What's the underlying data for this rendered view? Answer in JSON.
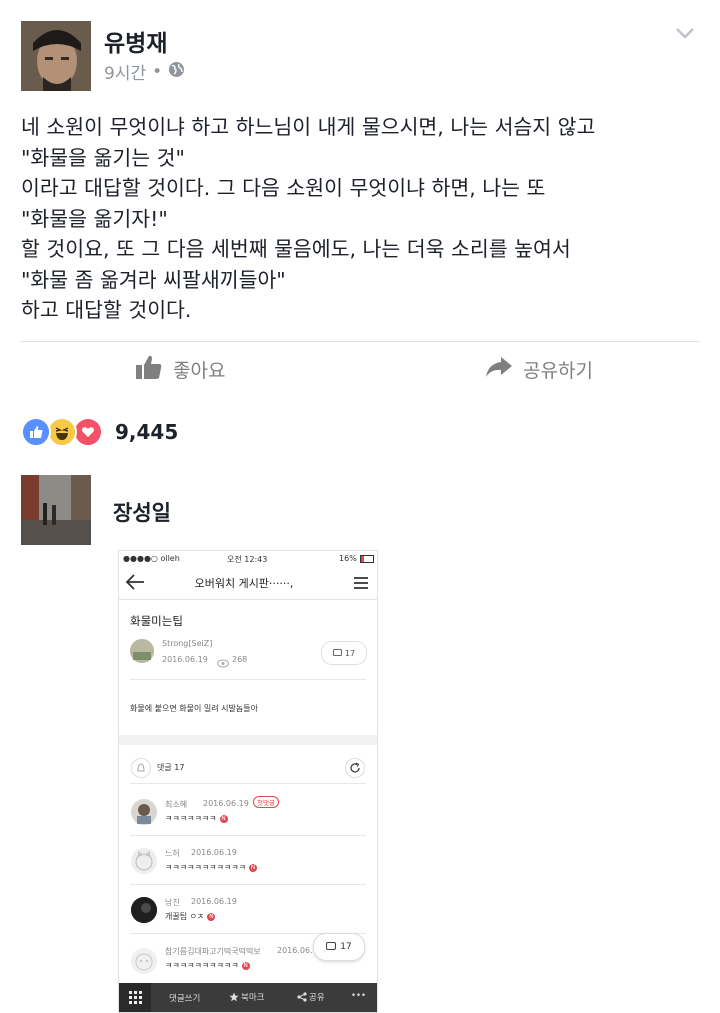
{
  "post": {
    "author": "유병재",
    "time": "9시간",
    "dot": "•",
    "lines": [
      "네 소원이 무엇이냐 하고 하느님이 내게 물으시면, 나는 서슴지 않고",
      "\"화물을 옮기는 것\"",
      "이라고 대답할 것이다. 그 다음 소원이 무엇이냐 하면, 나는 또",
      "\"화물을 옮기자!\"",
      "할 것이요, 또 그 다음 세번째 물음에도, 나는 더욱 소리를 높여서",
      "\"화물 좀 옮겨라 씨팔새끼들아\"",
      "하고 대답할 것이다."
    ]
  },
  "actions": {
    "like_label": "좋아요",
    "share_label": "공유하기"
  },
  "reactions": {
    "count": "9,445",
    "icons": [
      "like-icon",
      "haha-icon",
      "love-icon"
    ],
    "colors": {
      "like": "#5890ff",
      "haha": "#f7c946",
      "love": "#f25268"
    }
  },
  "comment": {
    "author": "장성일"
  },
  "screenshot": {
    "status": {
      "carrier": "●●●●○ olleh",
      "time": "오전 12:43",
      "battery": "16%"
    },
    "nav_title": "오버워치 게시판······,",
    "post_title": "화물미는팁",
    "post_author": "Strong[SeiZ]",
    "post_date": "2016.06.19",
    "post_views": "268",
    "post_comments": "17",
    "post_body": "화물에 붙으면 화물이 밀려 시발놈들아",
    "comment_header": "댓글 17",
    "comments": [
      {
        "name": "최소혜",
        "date": "2016.06.19",
        "badge": "첫댓글",
        "text": "ㅋㅋㅋㅋㅋㅋㅋ"
      },
      {
        "name": "느허",
        "date": "2016.06.19",
        "text": "ㅋㅋㅋㅋㅋㅋㅋㅋㅋㅋㅋ"
      },
      {
        "name": "남친",
        "date": "2016.06.19",
        "text": "개꿀팁 ㅇㅈ"
      },
      {
        "name": "참기름김대파고기떡국떡떡보",
        "date": "2016.06.",
        "text": "ㅋㅋㅋㅋㅋㅋㅋㅋㅋㅋ"
      }
    ],
    "floating_count": "17",
    "badge_letter": "N",
    "bottom": {
      "write": "댓글쓰기",
      "bookmark": "북마크",
      "share": "공유",
      "more": "•••"
    }
  }
}
